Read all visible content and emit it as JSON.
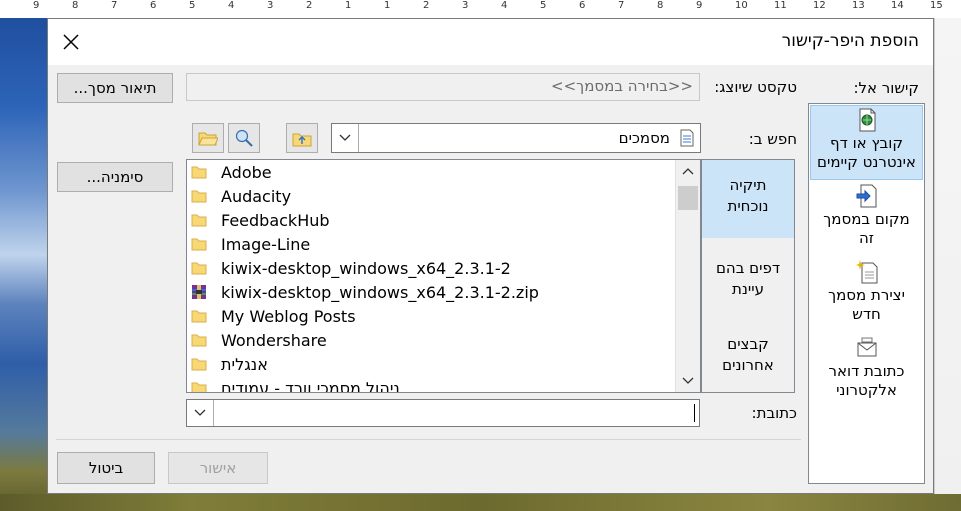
{
  "ruler": [
    "15",
    "14",
    "13",
    "12",
    "11",
    "10",
    "9",
    "8",
    "7",
    "6",
    "5",
    "4",
    "3",
    "2",
    "1",
    "1",
    "2",
    "3",
    "4",
    "5",
    "6",
    "7",
    "8",
    "9"
  ],
  "dialog": {
    "title": "הוספת היפר-קישור",
    "link_to_label": "קישור אל:",
    "link_to": [
      {
        "label_line1": "קובץ או דף",
        "label_line2": "אינטרנט קיימים",
        "icon": "web-page-icon",
        "selected": true
      },
      {
        "label_line1": "מקום במסמך",
        "label_line2": "זה",
        "icon": "document-place-icon",
        "selected": false
      },
      {
        "label_line1": "יצירת מסמך",
        "label_line2": "חדש",
        "icon": "new-document-icon",
        "selected": false
      },
      {
        "label_line1": "כתובת דואר",
        "label_line2": "אלקטרוני",
        "icon": "email-icon",
        "selected": false
      }
    ],
    "text_to_display_label": "טקסט שיוצג:",
    "text_to_display_value": "<<בחירה במסמך>>",
    "screentip_button": "תיאור מסך...",
    "look_in_label": "חפש ב:",
    "look_in_value": "מסמכים",
    "bookmark_button": "סימניה...",
    "places": [
      {
        "line1": "תיקיה",
        "line2": "נוכחית",
        "selected": true
      },
      {
        "line1": "דפים בהם",
        "line2": "עיינת",
        "selected": false
      },
      {
        "line1": "קבצים",
        "line2": "אחרונים",
        "selected": false
      }
    ],
    "files": [
      {
        "name": "Adobe",
        "type": "folder"
      },
      {
        "name": "Audacity",
        "type": "folder"
      },
      {
        "name": "FeedbackHub",
        "type": "folder"
      },
      {
        "name": "Image-Line",
        "type": "folder"
      },
      {
        "name": "kiwix-desktop_windows_x64_2.3.1-2",
        "type": "folder"
      },
      {
        "name": "kiwix-desktop_windows_x64_2.3.1-2.zip",
        "type": "zip"
      },
      {
        "name": "My Weblog Posts",
        "type": "folder"
      },
      {
        "name": "Wondershare",
        "type": "folder"
      },
      {
        "name": "אנגלית",
        "type": "folder"
      },
      {
        "name": "ניהול מסמכי וורד - עמודים",
        "type": "folder"
      }
    ],
    "address_label": "כתובת:",
    "address_value": "",
    "ok_button": "אישור",
    "cancel_button": "ביטול"
  },
  "colors": {
    "selected_bg": "#cce4f7",
    "folder": "#f8d775",
    "dialog_bg": "#f0f0f0"
  }
}
